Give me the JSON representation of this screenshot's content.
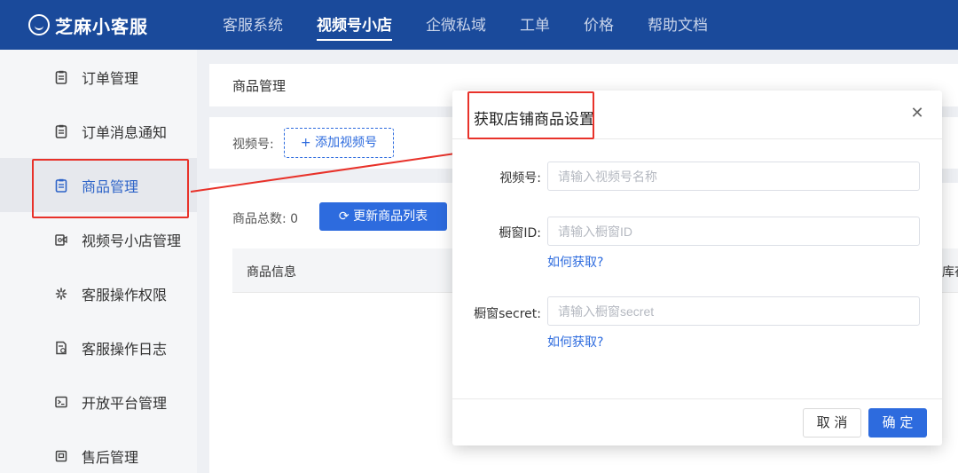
{
  "app": {
    "name": "芝麻小客服"
  },
  "nav": {
    "items": [
      {
        "label": "客服系统"
      },
      {
        "label": "视频号小店"
      },
      {
        "label": "企微私域"
      },
      {
        "label": "工单"
      },
      {
        "label": "价格"
      },
      {
        "label": "帮助文档"
      }
    ],
    "active": "视频号小店"
  },
  "sidebar": {
    "items": [
      {
        "label": "订单管理",
        "icon": "clipboard-icon"
      },
      {
        "label": "订单消息通知",
        "icon": "clipboard-icon"
      },
      {
        "label": "商品管理",
        "icon": "clipboard-icon"
      },
      {
        "label": "视频号小店管理",
        "icon": "store-icon"
      },
      {
        "label": "客服操作权限",
        "icon": "spark-icon"
      },
      {
        "label": "客服操作日志",
        "icon": "log-icon"
      },
      {
        "label": "开放平台管理",
        "icon": "terminal-icon"
      },
      {
        "label": "售后管理",
        "icon": "box-icon"
      }
    ],
    "active": "商品管理"
  },
  "main": {
    "page_title": "商品管理",
    "filter": {
      "label": "视频号:",
      "add_button": "+ 添加视频号"
    },
    "list": {
      "total_label": "商品总数: 0",
      "refresh_button": "更新商品列表",
      "columns": [
        "商品信息",
        "库存"
      ]
    }
  },
  "dialog": {
    "title": "获取店铺商品设置",
    "close_icon": "close-icon",
    "fields": [
      {
        "label": "视频号:",
        "placeholder": "请输入视频号名称",
        "value": ""
      },
      {
        "label": "橱窗ID:",
        "placeholder": "请输入橱窗ID",
        "value": "",
        "help": "如何获取?"
      },
      {
        "label": "橱窗secret:",
        "placeholder": "请输入橱窗secret",
        "value": "",
        "help": "如何获取?"
      }
    ],
    "cancel_label": "取 消",
    "ok_label": "确 定"
  },
  "colors": {
    "topbar": "#1a4a9b",
    "primary": "#2d6bde",
    "annotation": "#e8322a"
  }
}
